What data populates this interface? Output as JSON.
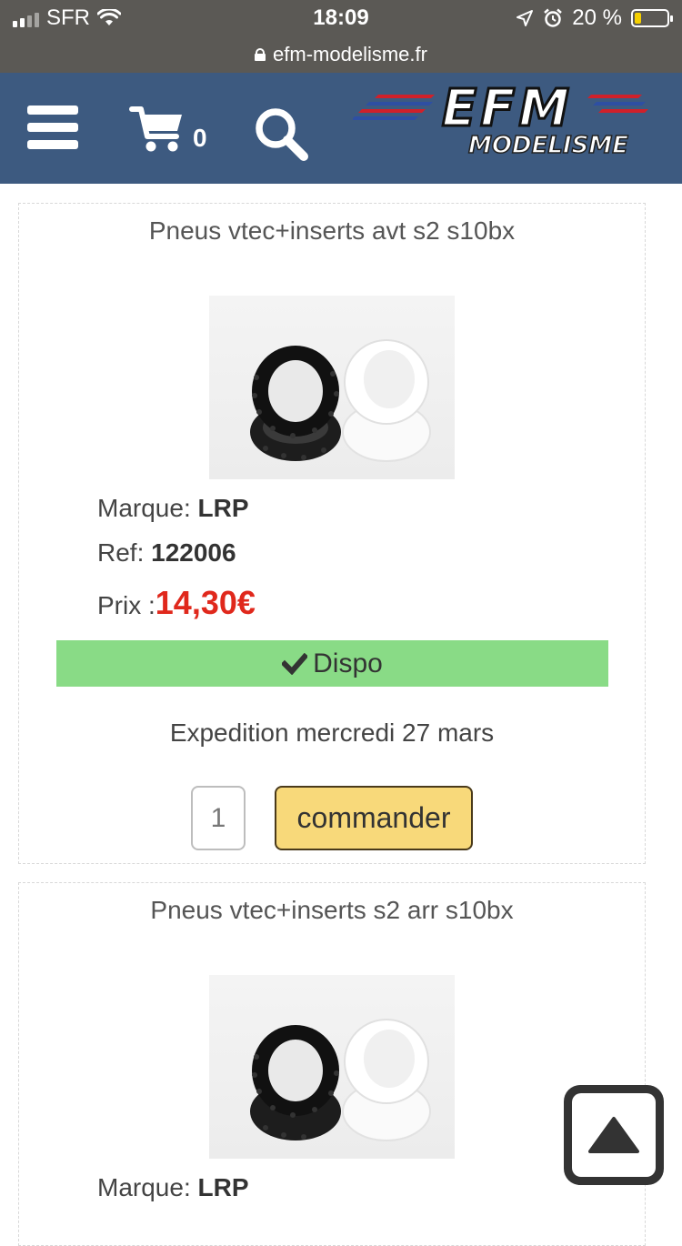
{
  "status_bar": {
    "carrier": "SFR",
    "time": "18:09",
    "battery": "20 %",
    "battery_level": 0.2
  },
  "browser": {
    "url": "efm-modelisme.fr"
  },
  "header": {
    "brand_main": "EFM",
    "brand_sub": "MODELISME",
    "cart_count": "0",
    "colors": {
      "background": "#3d5a80",
      "stripe_red": "#d0202a",
      "stripe_blue": "#2e4fa3"
    }
  },
  "products": [
    {
      "title": "Pneus vtec+inserts avt s2 s10bx",
      "brand_label": "Marque:",
      "brand": "LRP",
      "ref_label": "Ref:",
      "ref": "122006",
      "price_label": "Prix :",
      "price": "14,30€",
      "availability": "Dispo",
      "shipping": "Expedition mercredi 27 mars",
      "quantity": "1",
      "order_label": "commander"
    },
    {
      "title": "Pneus vtec+inserts s2 arr s10bx",
      "brand_label": "Marque:",
      "brand": "LRP"
    }
  ],
  "colors": {
    "price": "#e0281c",
    "dispo_bg": "#89db86",
    "order_bg": "#f8d97a"
  },
  "icons": {
    "menu": "hamburger-icon",
    "cart": "cart-icon",
    "search": "search-icon",
    "available": "check-icon",
    "scroll_top": "arrow-up-icon"
  }
}
